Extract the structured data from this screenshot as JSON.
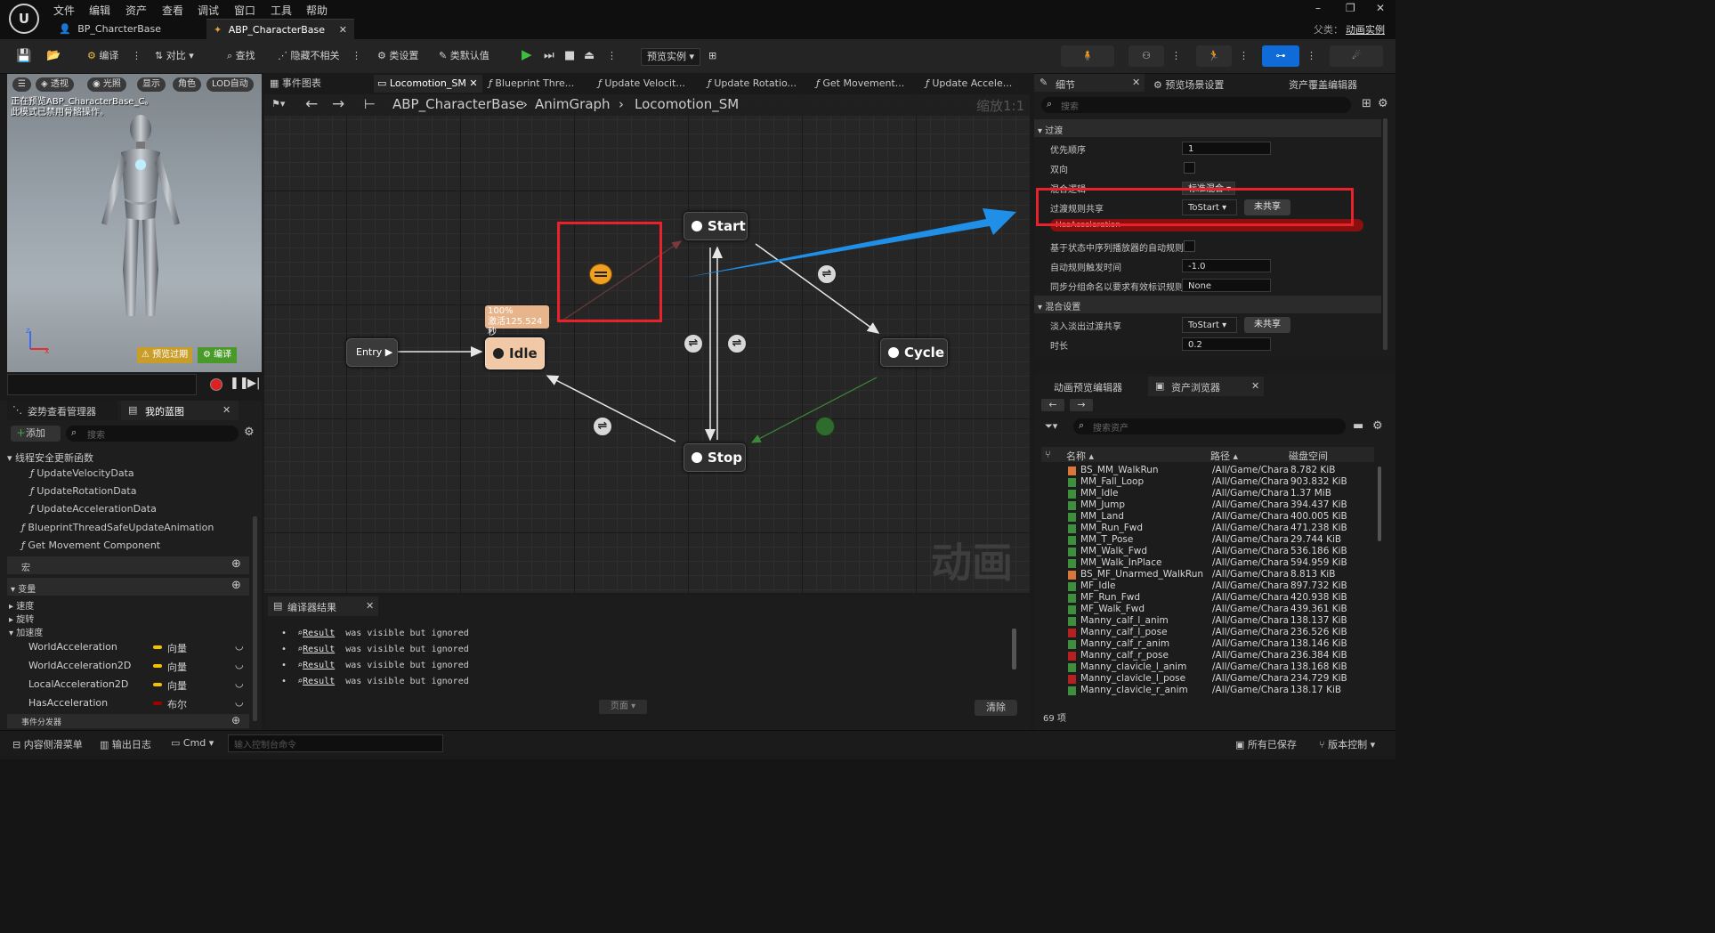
{
  "menu": [
    "文件",
    "编辑",
    "资产",
    "查看",
    "调试",
    "窗口",
    "工具",
    "帮助"
  ],
  "doc_tabs": [
    "BP_CharcterBase",
    "ABP_CharacterBase"
  ],
  "parent_label": "父类：",
  "parent_value": "动画实例",
  "window_controls": [
    "–",
    "❐",
    "✕"
  ],
  "toolbar": {
    "compile": "编译",
    "diff": "对比",
    "find": "查找",
    "hide_unrelated": "隐藏不相关",
    "class_settings": "类设置",
    "class_defaults": "类默认值",
    "preview_instance": "预览实例"
  },
  "viewport": {
    "buttons": [
      "透视",
      "光照",
      "显示",
      "角色",
      "LOD自动"
    ],
    "notice": "正在预览ABP_CharacterBase_C。\n此模式已禁用骨骼操作。",
    "preview_badge": "预览过期",
    "compile_badge": "编译"
  },
  "left_panel": {
    "tabs": [
      "姿势查看管理器",
      "我的蓝图"
    ],
    "add_label": "添加",
    "search_placeholder": "搜索",
    "section_thread": "线程安全更新函数",
    "functions": [
      "UpdateVelocityData",
      "UpdateRotationData",
      "UpdateAccelerationData"
    ],
    "other_functions": [
      "BlueprintThreadSafeUpdateAnimation",
      "Get Movement Component"
    ],
    "section_macros": "宏",
    "section_variables": "变量",
    "var_groups": [
      "速度",
      "旋转",
      "加速度"
    ],
    "variables": [
      {
        "name": "WorldAcceleration",
        "type": "向量",
        "color": "#f2c200"
      },
      {
        "name": "WorldAcceleration2D",
        "type": "向量",
        "color": "#f2c200"
      },
      {
        "name": "LocalAcceleration2D",
        "type": "向量",
        "color": "#f2c200"
      },
      {
        "name": "HasAcceleration",
        "type": "布尔",
        "color": "#a10000"
      }
    ],
    "section_dispatchers": "事件分发器"
  },
  "graph_tabs": [
    "事件图表",
    "Locomotion_SM",
    "Blueprint Thre...",
    "Update Velocit...",
    "Update Rotatio...",
    "Get Movement...",
    "Update Accele..."
  ],
  "breadcrumb": [
    "ABP_CharacterBase",
    "AnimGraph",
    "Locomotion_SM"
  ],
  "zoom": "缩放1:1",
  "watermark": "动画",
  "nodes": {
    "entry": "Entry",
    "idle": "Idle",
    "start": "Start",
    "cycle": "Cycle",
    "stop": "Stop"
  },
  "idle_info": {
    "percent": "100%",
    "active": "激活125.524秒"
  },
  "compiler": {
    "tab": "编译器结果",
    "lines": [
      {
        "link": "Result",
        "text": "was visible but ignored"
      },
      {
        "link": "Result",
        "text": "was visible but ignored"
      },
      {
        "link": "Result",
        "text": "was visible but ignored"
      },
      {
        "link": "Result",
        "text": "was visible but ignored"
      }
    ],
    "page_label": "页面",
    "clear_label": "清除"
  },
  "details": {
    "tabs": [
      "细节",
      "预览场景设置",
      "资产覆盖编辑器"
    ],
    "search_placeholder": "搜索",
    "section_transition": "过渡",
    "rows": [
      {
        "label": "优先顺序",
        "value": "1"
      },
      {
        "label": "双向",
        "value": ""
      },
      {
        "label": "混合逻辑",
        "value": "标准混合"
      },
      {
        "label": "过渡规则共享",
        "value": "ToStart",
        "button": "未共享"
      },
      {
        "label": "",
        "value": "HasAcceleration"
      },
      {
        "label": "基于状态中序列播放器的自动规则",
        "value": ""
      },
      {
        "label": "自动规则触发时间",
        "value": "-1.0"
      },
      {
        "label": "同步分组命名以要求有效标识规则",
        "value": "None"
      }
    ],
    "section_blend": "混合设置",
    "blend_rows": [
      {
        "label": "淡入淡出过渡共享",
        "value": "ToStart",
        "button": "未共享"
      },
      {
        "label": "时长",
        "value": "0.2"
      }
    ]
  },
  "assets": {
    "tabs": [
      "动画预览编辑器",
      "资产浏览器"
    ],
    "search_placeholder": "搜索资产",
    "columns": [
      "名称",
      "路径",
      "磁盘空间"
    ],
    "rows": [
      {
        "name": "BS_MM_WalkRun",
        "path": "/All/Game/Chara",
        "size": "8.782 KiB",
        "color": "#d9763a"
      },
      {
        "name": "MM_Fall_Loop",
        "path": "/All/Game/Chara",
        "size": "903.832 KiB",
        "color": "#3d8f3d"
      },
      {
        "name": "MM_Idle",
        "path": "/All/Game/Chara",
        "size": "1.37 MiB",
        "color": "#3d8f3d"
      },
      {
        "name": "MM_Jump",
        "path": "/All/Game/Chara",
        "size": "394.437 KiB",
        "color": "#3d8f3d"
      },
      {
        "name": "MM_Land",
        "path": "/All/Game/Chara",
        "size": "400.005 KiB",
        "color": "#3d8f3d"
      },
      {
        "name": "MM_Run_Fwd",
        "path": "/All/Game/Chara",
        "size": "471.238 KiB",
        "color": "#3d8f3d"
      },
      {
        "name": "MM_T_Pose",
        "path": "/All/Game/Chara",
        "size": "29.744 KiB",
        "color": "#3d8f3d"
      },
      {
        "name": "MM_Walk_Fwd",
        "path": "/All/Game/Chara",
        "size": "536.186 KiB",
        "color": "#3d8f3d"
      },
      {
        "name": "MM_Walk_InPlace",
        "path": "/All/Game/Chara",
        "size": "594.959 KiB",
        "color": "#3d8f3d"
      },
      {
        "name": "BS_MF_Unarmed_WalkRun",
        "path": "/All/Game/Chara",
        "size": "8.813 KiB",
        "color": "#d9763a"
      },
      {
        "name": "MF_Idle",
        "path": "/All/Game/Chara",
        "size": "897.732 KiB",
        "color": "#3d8f3d"
      },
      {
        "name": "MF_Run_Fwd",
        "path": "/All/Game/Chara",
        "size": "420.938 KiB",
        "color": "#3d8f3d"
      },
      {
        "name": "MF_Walk_Fwd",
        "path": "/All/Game/Chara",
        "size": "439.361 KiB",
        "color": "#3d8f3d"
      },
      {
        "name": "Manny_calf_l_anim",
        "path": "/All/Game/Chara",
        "size": "138.137 KiB",
        "color": "#3d8f3d"
      },
      {
        "name": "Manny_calf_l_pose",
        "path": "/All/Game/Chara",
        "size": "236.526 KiB",
        "color": "#b52020"
      },
      {
        "name": "Manny_calf_r_anim",
        "path": "/All/Game/Chara",
        "size": "138.146 KiB",
        "color": "#3d8f3d"
      },
      {
        "name": "Manny_calf_r_pose",
        "path": "/All/Game/Chara",
        "size": "236.384 KiB",
        "color": "#b52020"
      },
      {
        "name": "Manny_clavicle_l_anim",
        "path": "/All/Game/Chara",
        "size": "138.168 KiB",
        "color": "#3d8f3d"
      },
      {
        "name": "Manny_clavicle_l_pose",
        "path": "/All/Game/Chara",
        "size": "234.729 KiB",
        "color": "#b52020"
      },
      {
        "name": "Manny_clavicle_r_anim",
        "path": "/All/Game/Chara",
        "size": "138.17 KiB",
        "color": "#3d8f3d"
      }
    ],
    "count": "69 项"
  },
  "statusbar": {
    "content_drawer": "内容侧滑菜单",
    "output_log": "输出日志",
    "cmd": "Cmd",
    "console_placeholder": "输入控制台命令",
    "saved": "所有已保存",
    "source_control": "版本控制"
  },
  "colors": {
    "highlight_red": "#e8222a",
    "arrow_blue": "#1f8fe8",
    "node_idle": "#f2c9a6",
    "accent_blue": "#0f6bd8"
  }
}
